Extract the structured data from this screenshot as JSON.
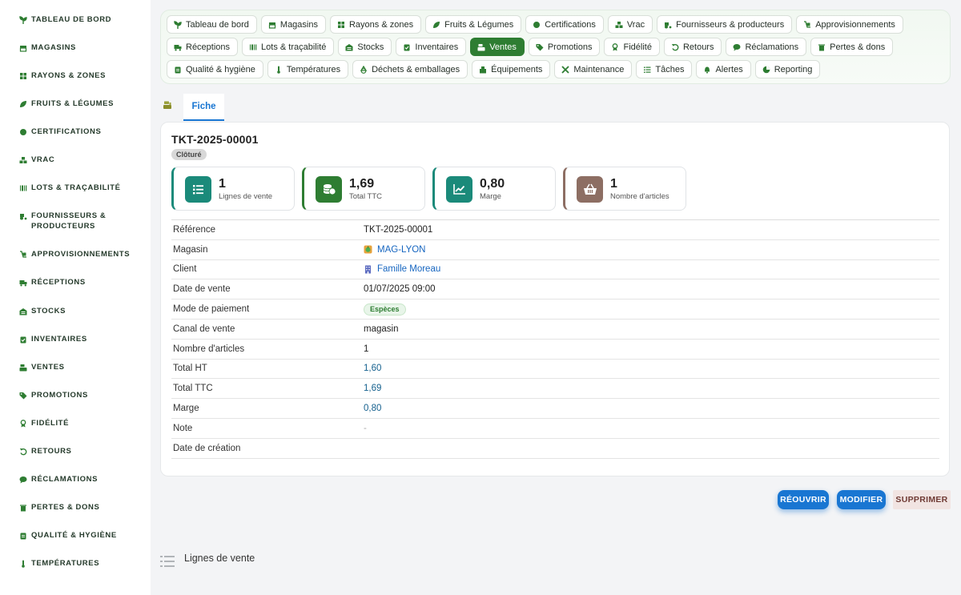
{
  "sidebar": {
    "items": [
      {
        "label": "Tableau de bord",
        "icon": "seedling-icon"
      },
      {
        "label": "Magasins",
        "icon": "store-icon"
      },
      {
        "label": "Rayons & zones",
        "icon": "grid-icon"
      },
      {
        "label": "Fruits & Légumes",
        "icon": "leaf-icon"
      },
      {
        "label": "Certifications",
        "icon": "certificate-icon"
      },
      {
        "label": "Vrac",
        "icon": "boxes-icon"
      },
      {
        "label": "Lots & traçabilité",
        "icon": "barcode-icon"
      },
      {
        "label": "Fournisseurs & producteurs",
        "icon": "tractor-icon"
      },
      {
        "label": "Approvisionnements",
        "icon": "dolly-icon"
      },
      {
        "label": "Réceptions",
        "icon": "truck-icon"
      },
      {
        "label": "Stocks",
        "icon": "warehouse-icon"
      },
      {
        "label": "Inventaires",
        "icon": "clipboard-check-icon"
      },
      {
        "label": "Ventes",
        "icon": "cash-register-icon"
      },
      {
        "label": "Promotions",
        "icon": "tag-icon"
      },
      {
        "label": "Fidélité",
        "icon": "award-icon"
      },
      {
        "label": "Retours",
        "icon": "undo-icon"
      },
      {
        "label": "Réclamations",
        "icon": "comment-icon"
      },
      {
        "label": "Pertes & dons",
        "icon": "trash-icon"
      },
      {
        "label": "Qualité & hygiène",
        "icon": "clipboard-icon"
      },
      {
        "label": "Températures",
        "icon": "thermometer-icon"
      }
    ]
  },
  "chips": [
    {
      "label": "Tableau de bord",
      "icon": "seedling-icon"
    },
    {
      "label": "Magasins",
      "icon": "store-icon"
    },
    {
      "label": "Rayons & zones",
      "icon": "grid-icon"
    },
    {
      "label": "Fruits & Légumes",
      "icon": "leaf-icon"
    },
    {
      "label": "Certifications",
      "icon": "certificate-icon"
    },
    {
      "label": "Vrac",
      "icon": "boxes-icon"
    },
    {
      "label": "Fournisseurs & producteurs",
      "icon": "tractor-icon"
    },
    {
      "label": "Approvisionnements",
      "icon": "dolly-icon"
    },
    {
      "label": "Réceptions",
      "icon": "truck-icon"
    },
    {
      "label": "Lots & traçabilité",
      "icon": "barcode-icon"
    },
    {
      "label": "Stocks",
      "icon": "warehouse-icon"
    },
    {
      "label": "Inventaires",
      "icon": "clipboard-check-icon"
    },
    {
      "label": "Ventes",
      "icon": "cash-register-icon"
    },
    {
      "label": "Promotions",
      "icon": "tag-icon"
    },
    {
      "label": "Fidélité",
      "icon": "award-icon"
    },
    {
      "label": "Retours",
      "icon": "undo-icon"
    },
    {
      "label": "Réclamations",
      "icon": "comment-icon"
    },
    {
      "label": "Pertes & dons",
      "icon": "trash-icon"
    },
    {
      "label": "Qualité & hygiène",
      "icon": "clipboard-icon"
    },
    {
      "label": "Températures",
      "icon": "thermometer-icon"
    },
    {
      "label": "Déchets & emballages",
      "icon": "recycle-icon"
    },
    {
      "label": "Équipements",
      "icon": "equipment-icon"
    },
    {
      "label": "Maintenance",
      "icon": "tools-icon"
    },
    {
      "label": "Tâches",
      "icon": "tasks-icon"
    },
    {
      "label": "Alertes",
      "icon": "bell-icon"
    },
    {
      "label": "Reporting",
      "icon": "chart-pie-icon"
    }
  ],
  "active_chip": "Ventes",
  "tabs": {
    "fiche": "Fiche"
  },
  "record": {
    "title": "TKT-2025-00001",
    "status": "Clôturé"
  },
  "stats": [
    {
      "value": "1",
      "label": "Lignes de vente",
      "icon": "list-icon",
      "color": "#1b8a7a"
    },
    {
      "value": "1,69",
      "label": "Total TTC",
      "icon": "coins-icon",
      "color": "#2e7d32"
    },
    {
      "value": "0,80",
      "label": "Marge",
      "icon": "chart-line-icon",
      "color": "#1b8a7a"
    },
    {
      "value": "1",
      "label": "Nombre d'articles",
      "icon": "basket-icon",
      "color": "#8d6e63"
    }
  ],
  "details": {
    "reference": {
      "label": "Référence",
      "value": "TKT-2025-00001"
    },
    "magasin": {
      "label": "Magasin",
      "value": "MAG-LYON"
    },
    "client": {
      "label": "Client",
      "value": "Famille Moreau"
    },
    "date_vente": {
      "label": "Date de vente",
      "value": "01/07/2025 09:00"
    },
    "mode_paiement": {
      "label": "Mode de paiement",
      "value": "Espèces"
    },
    "canal": {
      "label": "Canal de vente",
      "value": "magasin"
    },
    "nb_articles": {
      "label": "Nombre d'articles",
      "value": "1"
    },
    "total_ht": {
      "label": "Total HT",
      "value": "1,60"
    },
    "total_ttc": {
      "label": "Total TTC",
      "value": "1,69"
    },
    "marge": {
      "label": "Marge",
      "value": "0,80"
    },
    "note": {
      "label": "Note",
      "value": "-"
    },
    "date_creation": {
      "label": "Date de création",
      "value": ""
    }
  },
  "actions": {
    "reopen": "RÉOUVRIR",
    "edit": "MODIFIER",
    "delete": "SUPPRIMER"
  },
  "section": {
    "title": "Lignes de vente"
  },
  "colors": {
    "primary_green": "#2e7d32",
    "accent_blue": "#1976d2",
    "teal": "#1b8a7a"
  }
}
